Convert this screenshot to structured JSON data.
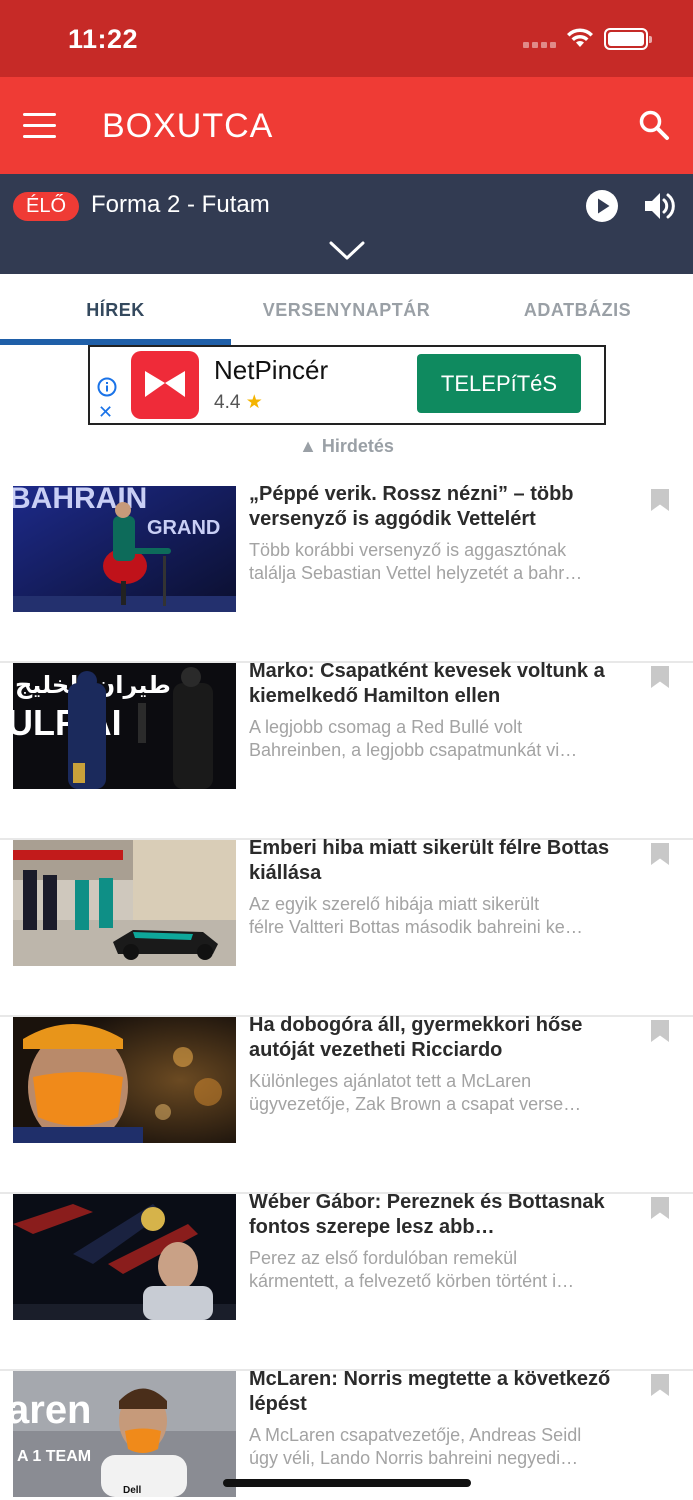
{
  "status_bar": {
    "time": "11:22"
  },
  "header": {
    "logo": "BOXUTCA"
  },
  "live": {
    "badge": "ÉLŐ",
    "title": "Forma 2 - Futam"
  },
  "tabs": [
    {
      "label": "HÍREK",
      "active": true
    },
    {
      "label": "VERSENYNAPTÁR",
      "active": false
    },
    {
      "label": "ADATBÁZIS",
      "active": false
    }
  ],
  "ad": {
    "app_name": "NetPincér",
    "rating": "4.4",
    "star": "★",
    "install_label": "TELEPíTéS",
    "label": "▲ Hirdetés"
  },
  "articles": [
    {
      "title": "„Péppé verik. Rossz nézni” – több versenyző is aggódik Vettelért",
      "excerpt_line1": "Több korábbi versenyző is aggasztónak",
      "excerpt_line2": "találja Sebastian Vettel helyzetét a bahr…",
      "thumb_text": "BAHRAIN",
      "thumb_text2": "GRAND"
    },
    {
      "title": "Marko: Csapatként kevesek voltunk a kiemelkedő Hamilton ellen",
      "excerpt_line1": "A legjobb csomag a Red Bullé volt",
      "excerpt_line2": "Bahreinben, a legjobb csapatmunkát vi…",
      "thumb_text": "طيران الخليج",
      "thumb_text2": "ULF AI"
    },
    {
      "title": "Emberi hiba miatt sikerült félre Bottas kiállása",
      "excerpt_line1": "Az egyik szerelő hibája miatt sikerült",
      "excerpt_line2": "félre Valtteri Bottas második bahreini ke…"
    },
    {
      "title": "Ha dobogóra áll, gyermekkori hőse autóját vezetheti Ricciardo",
      "excerpt_line1": "Különleges ajánlatot tett a McLaren",
      "excerpt_line2": "ügyvezetője, Zak Brown a csapat verse…"
    },
    {
      "title": "Wéber Gábor: Pereznek és Bottasnak fontos szerepe lesz abb…",
      "excerpt_line1": "Perez az első fordulóban remekül",
      "excerpt_line2": "kármentett, a felvezető körben történt i…"
    },
    {
      "title": "McLaren: Norris megtette a következő lépést",
      "excerpt_line1": "A McLaren csapatvezetője, Andreas Seidl",
      "excerpt_line2": "úgy véli, Lando Norris bahreini negyedi…",
      "thumb_text": "aren",
      "thumb_text2": "A 1 TEAM",
      "thumb_text3": "Dell"
    }
  ]
}
